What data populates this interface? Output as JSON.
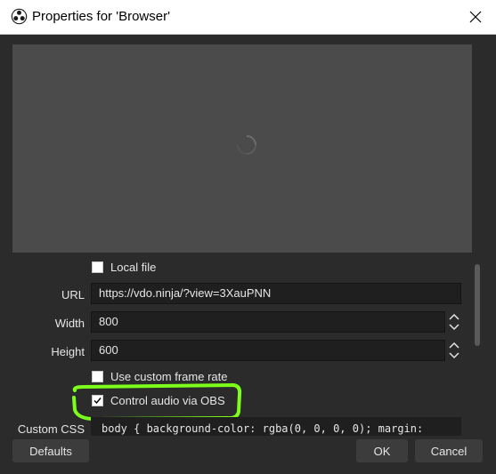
{
  "window": {
    "title": "Properties for 'Browser'"
  },
  "fields": {
    "local_file_label": "Local file",
    "local_file_checked": false,
    "url_label": "URL",
    "url_value": "https://vdo.ninja/?view=3XauPNN",
    "width_label": "Width",
    "width_value": "800",
    "height_label": "Height",
    "height_value": "600",
    "custom_fps_label": "Use custom frame rate",
    "custom_fps_checked": false,
    "control_audio_label": "Control audio via OBS",
    "control_audio_checked": true,
    "custom_css_label": "Custom CSS",
    "custom_css_value": "body { background-color: rgba(0, 0, 0, 0); margin:"
  },
  "buttons": {
    "defaults": "Defaults",
    "ok": "OK",
    "cancel": "Cancel"
  },
  "colors": {
    "annotation_highlight": "#7cff1a",
    "background": "#2b2b2b",
    "preview": "#4b4b4b"
  },
  "icons": {
    "app": "obs-logo-icon",
    "close": "close-icon",
    "loading": "loading-spinner-icon"
  }
}
